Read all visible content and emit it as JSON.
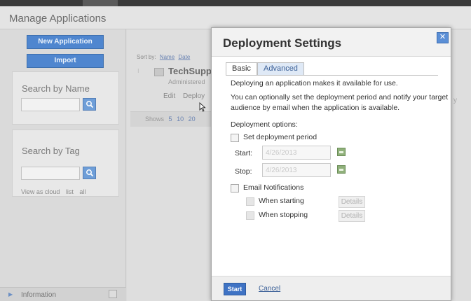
{
  "app": {
    "title": "Manage Applications"
  },
  "sidebar": {
    "new_app_label": "New Application",
    "import_label": "Import",
    "search_name": {
      "title": "Search by Name",
      "value": ""
    },
    "search_tag": {
      "title": "Search by Tag",
      "value": ""
    },
    "view_as_cloud": "View as cloud",
    "list": "list",
    "all": "all",
    "info_label": "Information"
  },
  "main": {
    "sort_by": "Sort by:",
    "sort_name": "Name",
    "sort_date": "Date",
    "app_name": "TechSupp",
    "app_admin": "Administered",
    "edit_label": "Edit",
    "deploy_label": "Deploy",
    "shows_label": "Shows",
    "shows_options": [
      "5",
      "10",
      "20"
    ],
    "ghost_text": "y"
  },
  "dialog": {
    "title": "Deployment Settings",
    "close_symbol": "✕",
    "tabs": {
      "basic": "Basic",
      "advanced": "Advanced"
    },
    "intro1": "Deploying an application makes it available for use.",
    "intro2a": "You can optionally set the deployment period and notify your target",
    "intro2b": "audience by email when the application is available.",
    "options_label": "Deployment options:",
    "set_period_label": "Set deployment period",
    "start_label": "Start:",
    "start_value": "4/26/2013",
    "stop_label": "Stop:",
    "stop_value": "4/26/2013",
    "email_label": "Email Notifications",
    "when_starting": "When starting",
    "when_stopping": "When stopping",
    "details_label": "Details",
    "start_button": "Start",
    "cancel_link": "Cancel"
  },
  "colors": {
    "accent": "#4f86cf",
    "dialog_bg": "#ffffff",
    "link": "#3a5f97"
  }
}
